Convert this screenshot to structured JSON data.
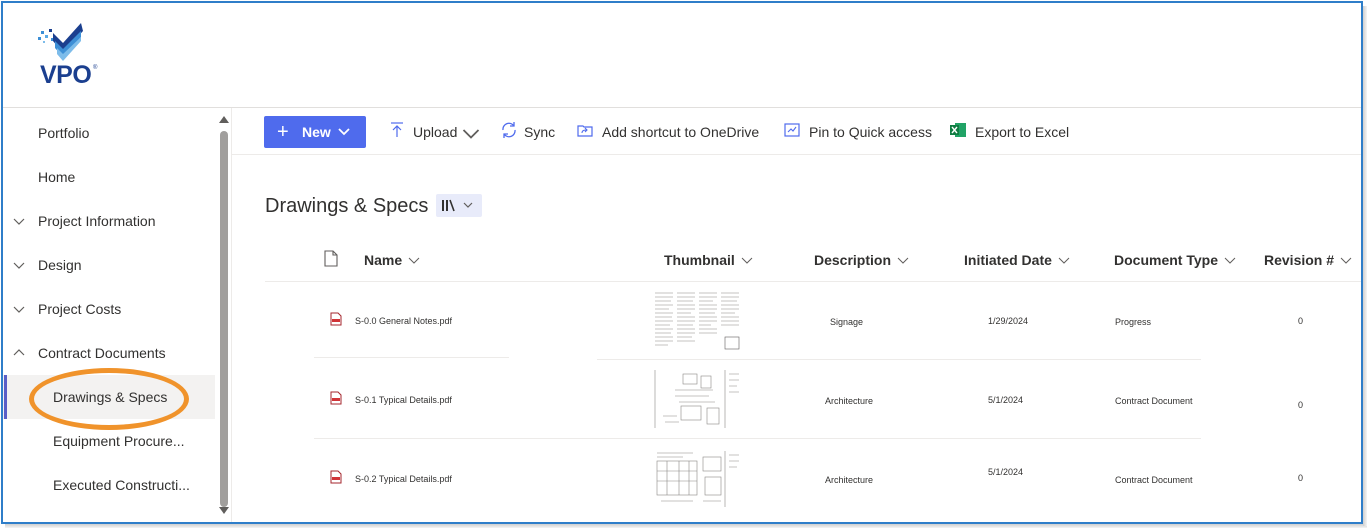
{
  "brand": {
    "logo_text": "VPO",
    "logo_reg": "®",
    "colors": {
      "navy": "#1b3f8f",
      "blue": "#3d8fd6",
      "accent": "#4f6bed",
      "highlight": "#f0932b"
    }
  },
  "nav": {
    "items": [
      {
        "label": "Portfolio",
        "chevron": ""
      },
      {
        "label": "Home",
        "chevron": ""
      },
      {
        "label": "Project Information",
        "chevron": "chevron-down-icon"
      },
      {
        "label": "Design",
        "chevron": "chevron-down-icon"
      },
      {
        "label": "Project Costs",
        "chevron": "chevron-down-icon"
      },
      {
        "label": "Contract Documents",
        "chevron": "chevron-up-icon"
      },
      {
        "label": "Drawings & Specs",
        "chevron": "",
        "selected": true
      },
      {
        "label": "Equipment Procure...",
        "chevron": ""
      },
      {
        "label": "Executed Constructi...",
        "chevron": ""
      }
    ]
  },
  "toolbar": {
    "new_label": "New",
    "upload_label": "Upload",
    "sync_label": "Sync",
    "shortcut_label": "Add shortcut to OneDrive",
    "pin_label": "Pin to Quick access",
    "excel_label": "Export to Excel"
  },
  "library": {
    "title": "Drawings & Specs"
  },
  "columns": {
    "name": "Name",
    "thumbnail": "Thumbnail",
    "description": "Description",
    "initiated": "Initiated Date",
    "doctype": "Document Type",
    "revision": "Revision #"
  },
  "rows": [
    {
      "name": "S-0.0 General Notes.pdf",
      "description": "Signage",
      "initiated": "1/29/2024",
      "doctype": "Progress",
      "revision": "0"
    },
    {
      "name": "S-0.1 Typical Details.pdf",
      "description": "Architecture",
      "initiated": "5/1/2024",
      "doctype": "Contract Document",
      "revision": "0"
    },
    {
      "name": "S-0.2 Typical Details.pdf",
      "description": "Architecture",
      "initiated": "5/1/2024",
      "doctype": "Contract Document",
      "revision": "0"
    }
  ]
}
